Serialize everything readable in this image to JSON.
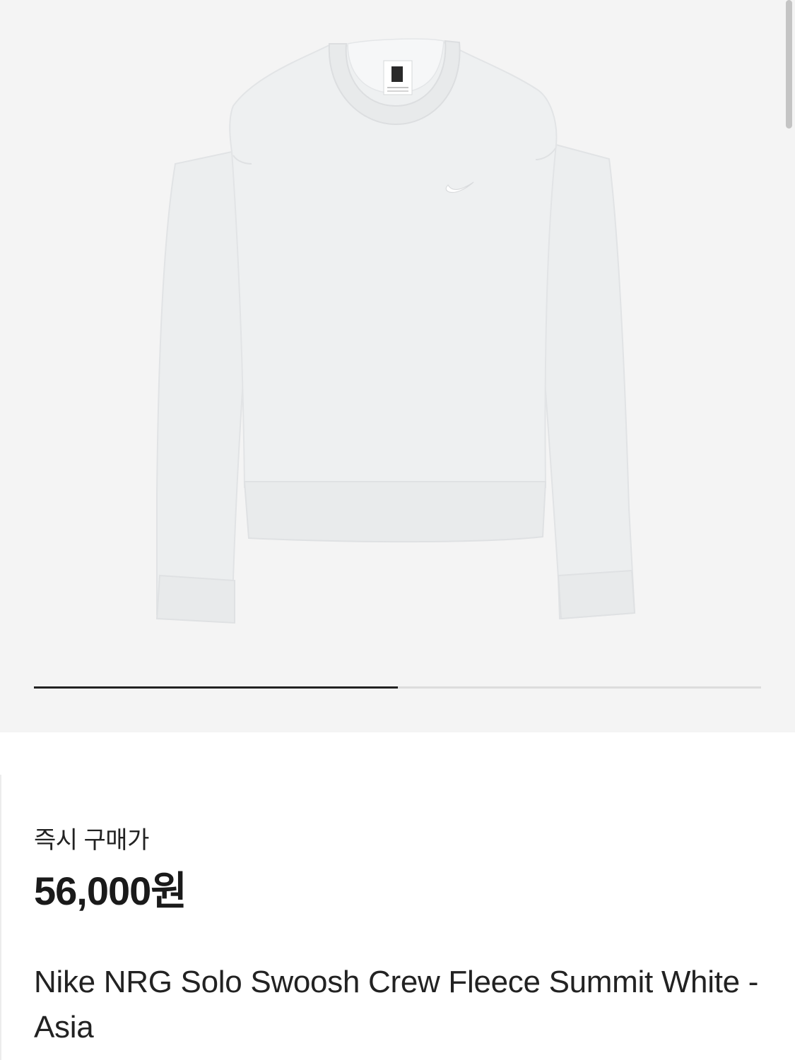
{
  "gallery": {
    "current_index": 1,
    "total_images": 2,
    "progress_fraction": 0.5
  },
  "product": {
    "price_label": "즉시 구매가",
    "price": "56,000원",
    "name": "Nike NRG Solo Swoosh Crew Fleece Summit White - Asia",
    "garment_color": "#edeff0",
    "background_color": "#f4f4f4"
  },
  "icons": {
    "brand_logo": "swoosh-icon"
  }
}
